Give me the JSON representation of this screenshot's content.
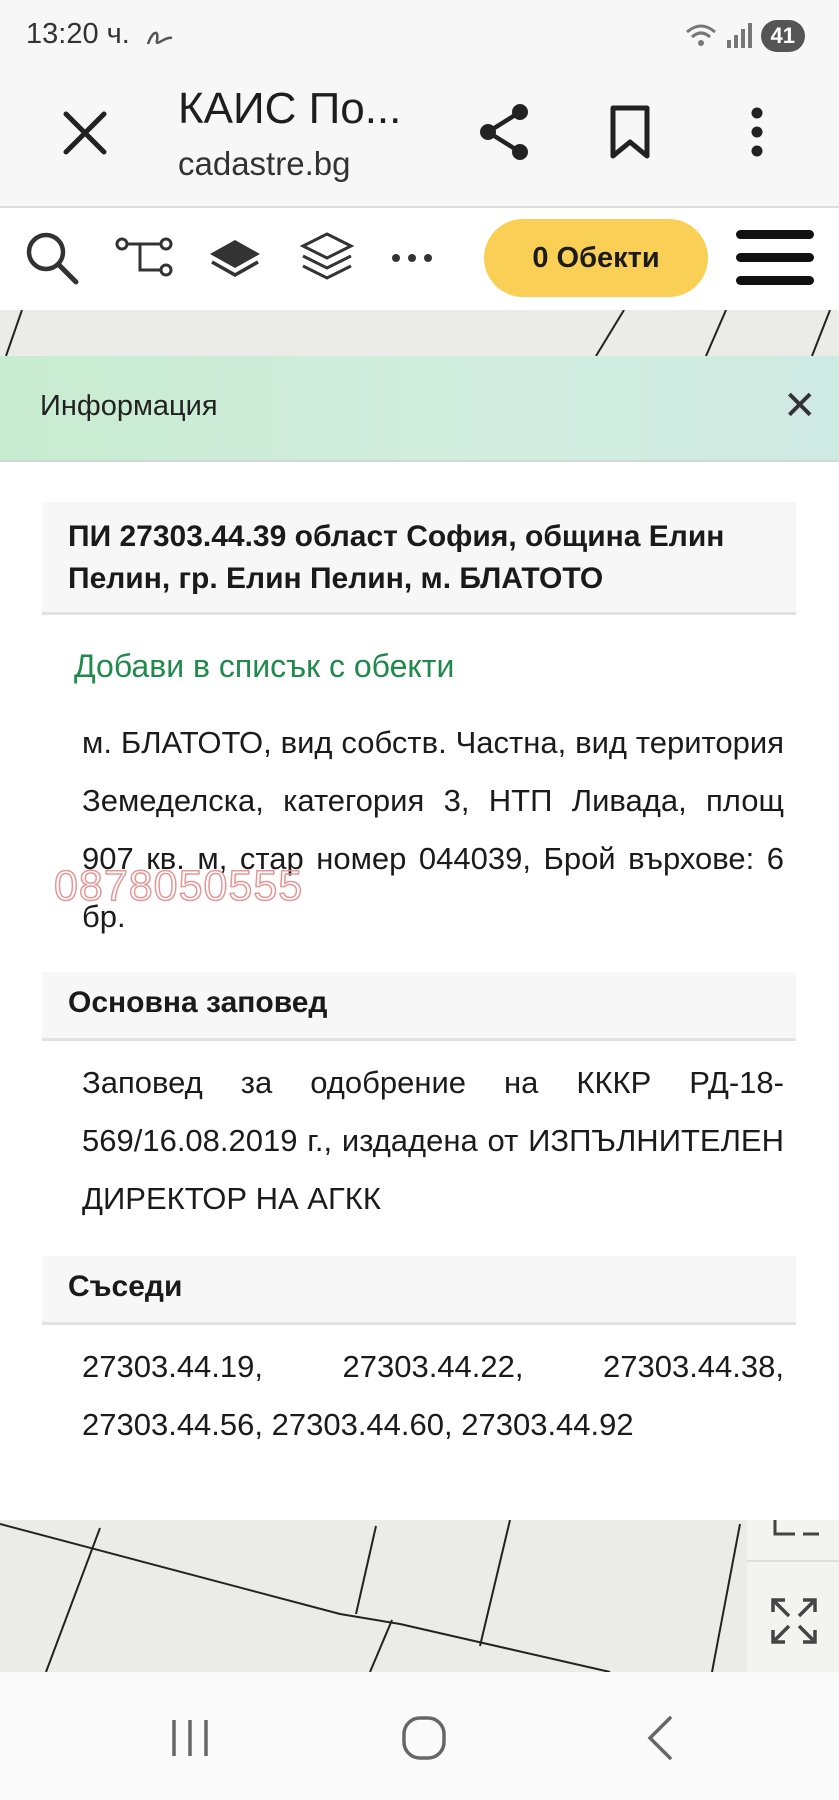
{
  "status": {
    "time": "13:20 ч.",
    "battery": "41",
    "icons": [
      "wifi-icon",
      "signal-icon",
      "handwriting-icon"
    ]
  },
  "browser": {
    "title": "КАИС По...",
    "url": "cadastre.bg",
    "icons": [
      "close-icon",
      "share-icon",
      "bookmark-icon",
      "more-vert-icon"
    ]
  },
  "toolbar": {
    "icons": [
      "search-icon",
      "route-icon",
      "layer-icon",
      "layers-icon",
      "more-horiz-icon",
      "hamburger-menu-icon"
    ],
    "objects_label": "0 Обекти",
    "objects_color": "#f9d055"
  },
  "info": {
    "header": "Информация",
    "close": "✕",
    "parcel_title": "ПИ 27303.44.39 област София, община Елин Пелин, гр. Елин Пелин, м. БЛАТОТО",
    "add_link": "Добави в списък с обекти",
    "add_link_color": "#1f8a4c",
    "description": "м. БЛАТОТО, вид собств. Частна, вид територия Земеделска, категория 3, НТП Ливада, площ 907 кв. м, стар номер 044039, Брой върхове: 6 бр.",
    "watermark": "0878050555",
    "order_head": "Основна заповед",
    "order_text": "Заповед за одобрение на КККР РД-18-569/16.08.2019 г., издадена от ИЗПЪЛНИТЕЛЕН ДИРЕКТОР НА АГКК",
    "neighbors_head": "Съседи",
    "neighbors_text": "27303.44.19, 27303.44.22, 27303.44.38, 27303.44.56, 27303.44.60, 27303.44.92"
  },
  "map_tools": [
    "fullscreen-icon"
  ],
  "navbar": {
    "icons": [
      "recent-apps-icon",
      "home-icon",
      "back-icon"
    ]
  }
}
